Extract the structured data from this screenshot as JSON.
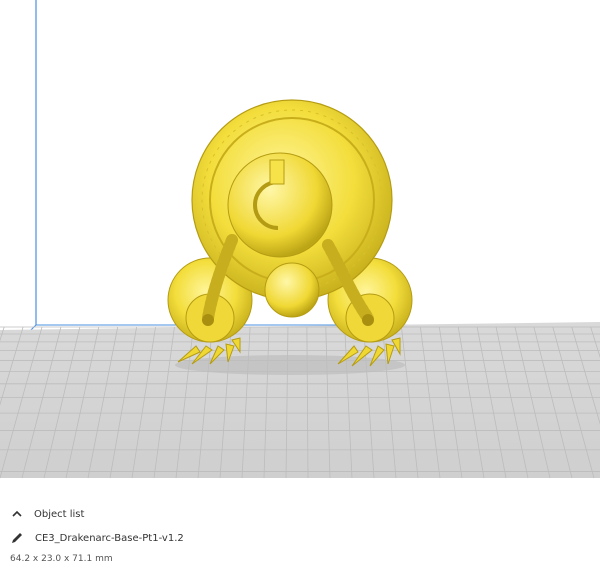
{
  "viewport": {
    "model_color": "#f6e34a",
    "build_plate_color": "#d4d4d4",
    "grid_line_color": "#bdbdbd",
    "volume_edge_color": "#4a90e2"
  },
  "object_list": {
    "header_icon": "chevron-up-icon",
    "header_label": "Object list",
    "item_icon": "pencil-icon",
    "object_name": "CE3_Drakenarc-Base-Pt1-v1.2",
    "dimensions": "64.2 x 23.0 x 71.1 mm"
  }
}
